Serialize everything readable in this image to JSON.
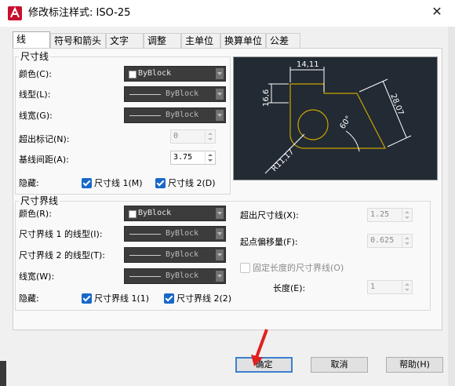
{
  "dialog": {
    "title": "修改标注样式: ISO-25"
  },
  "tabs": [
    "线",
    "符号和箭头",
    "文字",
    "调整",
    "主单位",
    "换算单位",
    "公差"
  ],
  "dim_lines": {
    "group_title": "尺寸线",
    "color_label": "颜色(C):",
    "color_value": "ByBlock",
    "linetype_label": "线型(L):",
    "linetype_value": "ByBlock",
    "lineweight_label": "线宽(G):",
    "lineweight_value": "ByBlock",
    "extend_ticks_label": "超出标记(N):",
    "extend_ticks_value": "0",
    "baseline_spacing_label": "基线间距(A):",
    "baseline_spacing_value": "3.75",
    "suppress_label": "隐藏:",
    "suppress_1": "尺寸线 1(M)",
    "suppress_2": "尺寸线 2(D)"
  },
  "ext_lines": {
    "group_title": "尺寸界线",
    "color_label": "颜色(R):",
    "color_value": "ByBlock",
    "linetype1_label": "尺寸界线 1 的线型(I):",
    "linetype1_value": "ByBlock",
    "linetype2_label": "尺寸界线 2 的线型(T):",
    "linetype2_value": "ByBlock",
    "lineweight_label": "线宽(W):",
    "lineweight_value": "ByBlock",
    "suppress_label": "隐藏:",
    "suppress_1": "尺寸界线 1(1)",
    "suppress_2": "尺寸界线 2(2)",
    "extend_beyond_label": "超出尺寸线(X):",
    "extend_beyond_value": "1.25",
    "offset_label": "起点偏移量(F):",
    "offset_value": "0.625",
    "fixed_length_label": "固定长度的尺寸界线(O)",
    "length_label": "长度(E):",
    "length_value": "1"
  },
  "preview": {
    "dim1": "14,11",
    "dim2": "16,6",
    "dim3": "28,07",
    "dim4": "60°",
    "dim5": "R11,17"
  },
  "buttons": {
    "ok": "确定",
    "cancel": "取消",
    "help": "帮助(H)"
  },
  "colors": {
    "accent": "#1868c8",
    "preview_bg": "#222a33",
    "preview_line": "#c9a400"
  }
}
